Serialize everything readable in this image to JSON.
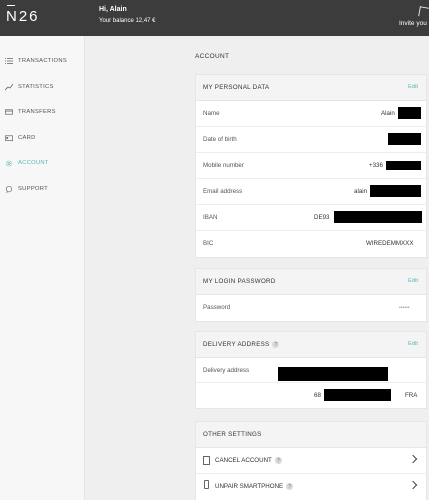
{
  "header": {
    "logo": "N26",
    "greeting": "Hi, Alain",
    "balance": "Your balance 12,47 €",
    "invite": "Invite you"
  },
  "sidebar": {
    "items": [
      {
        "label": "TRANSACTIONS",
        "icon": "list-icon"
      },
      {
        "label": "STATISTICS",
        "icon": "chart-line-icon"
      },
      {
        "label": "TRANSFERS",
        "icon": "transfer-icon"
      },
      {
        "label": "CARD",
        "icon": "card-icon"
      },
      {
        "label": "ACCOUNT",
        "icon": "gear-icon",
        "active": true
      },
      {
        "label": "SUPPORT",
        "icon": "chat-icon"
      }
    ],
    "active_color": "#5bb6b3"
  },
  "main": {
    "section_title": "ACCOUNT",
    "personal": {
      "title": "MY PERSONAL DATA",
      "edit": "Edit",
      "rows": [
        {
          "label": "Name",
          "value": "Alain"
        },
        {
          "label": "Date of birth",
          "value": ""
        },
        {
          "label": "Mobile number",
          "value": "+336"
        },
        {
          "label": "Email address",
          "value": "alain"
        },
        {
          "label": "IBAN",
          "value": "DE93"
        },
        {
          "label": "BIC",
          "value": "WIREDEMMXXX"
        }
      ]
    },
    "password": {
      "title": "MY LOGIN PASSWORD",
      "edit": "Edit",
      "label": "Password",
      "value": "••••••"
    },
    "delivery": {
      "title": "DELIVERY ADDRESS",
      "help": "?",
      "edit": "Edit",
      "label": "Delivery address",
      "line2_prefix": "68",
      "country": "FRA"
    },
    "other": {
      "title": "OTHER SETTINGS",
      "cancel": "CANCEL ACCOUNT",
      "unpair": "UNPAIR SMARTPHONE",
      "help": "?"
    }
  }
}
